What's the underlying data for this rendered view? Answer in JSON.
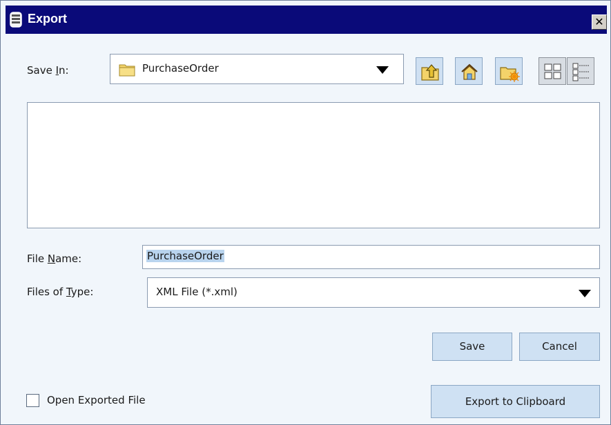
{
  "window": {
    "title": "Export",
    "close_glyph": "✕"
  },
  "save_in": {
    "label_prefix": "Save ",
    "label_mnemonic": "I",
    "label_suffix": "n:",
    "value": "PurchaseOrder",
    "icon": "folder-icon"
  },
  "toolbar": {
    "buttons": [
      {
        "name": "up-one-level-button",
        "icon": "folder-up-icon"
      },
      {
        "name": "home-button",
        "icon": "home-icon"
      },
      {
        "name": "new-folder-button",
        "icon": "new-folder-icon"
      },
      {
        "name": "list-view-button",
        "icon": "list-view-icon"
      },
      {
        "name": "details-view-button",
        "icon": "details-view-icon"
      }
    ]
  },
  "file_name": {
    "label_prefix": "File ",
    "label_mnemonic": "N",
    "label_suffix": "ame:",
    "value": "PurchaseOrder"
  },
  "file_type": {
    "label_prefix": "Files of ",
    "label_mnemonic": "T",
    "label_suffix": "ype:",
    "value": "XML File (*.xml)"
  },
  "buttons": {
    "save": "Save",
    "cancel": "Cancel",
    "export_clipboard": "Export to Clipboard"
  },
  "open_exported": {
    "label": "Open Exported File",
    "checked": false
  },
  "colors": {
    "titlebar": "#0a0a79",
    "dialog_bg": "#f1f6fb",
    "button_bg": "#cfe1f3",
    "selection": "#b9d4ee"
  }
}
